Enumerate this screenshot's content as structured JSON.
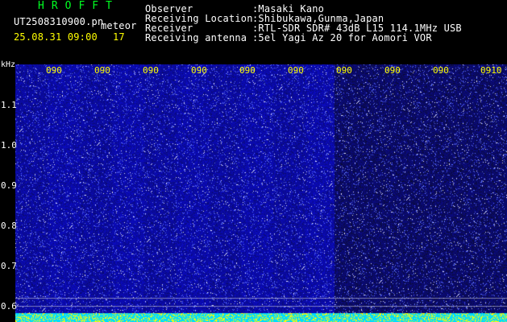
{
  "header": {
    "title": "HROFFT",
    "filename": "UT2508310900.pn",
    "filename_suffix": "meteor",
    "datetime": "25.08.31 09:00",
    "count": "17",
    "info": [
      {
        "label": "Observer",
        "value": ":Masaki Kano"
      },
      {
        "label": "Receiving Location",
        "value": ":Shibukawa,Gunma,Japan"
      },
      {
        "label": "Receiver",
        "value": ":RTL-SDR SDR# 43dB L15 114.1MHz USB"
      },
      {
        "label": "Receiving antenna",
        "value": ":5el Yagi Az 20 for Aomori VOR"
      }
    ]
  },
  "spectrogram": {
    "y_unit": "kHz",
    "y_ticks": [
      "1.1",
      "1.0",
      "0.9",
      "0.8",
      "0.7",
      "0.6"
    ],
    "x_ticks": [
      "090",
      "090",
      "090",
      "090",
      "090",
      "090",
      "090",
      "090",
      "090",
      "0910"
    ],
    "colors": {
      "background": "#1a1ab0",
      "darker_region": "#0a0a70",
      "speckle": "#ffffff",
      "cyan": "#00e5ff",
      "text_green": "#00ff22",
      "text_yellow": "#ffff00"
    }
  }
}
